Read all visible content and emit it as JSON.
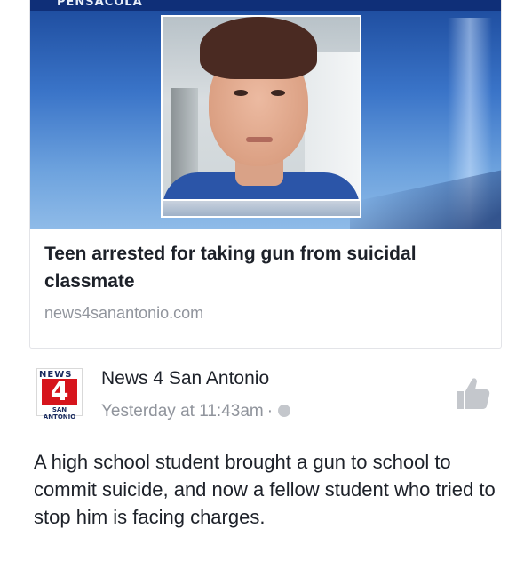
{
  "link_preview": {
    "station_tag": "PENSACOLA",
    "title": "Teen arrested for taking gun from suicidal classmate",
    "domain": "news4sanantonio.com"
  },
  "post": {
    "logo_top": "NEWS",
    "logo_number": "4",
    "logo_bottom": "SAN ANTONIO",
    "page_name": "News 4 San Antonio",
    "timestamp": "Yesterday at 11:43am",
    "separator": "·",
    "body": "A high school student brought a gun to school to commit suicide, and now a fellow student who tried to stop him is facing charges."
  },
  "icons": [
    "globe-icon",
    "like-icon"
  ],
  "colors": {
    "text_primary": "#1d2129",
    "text_secondary": "#90949c",
    "logo_red": "#d6141c",
    "logo_navy": "#1a2b5f"
  }
}
